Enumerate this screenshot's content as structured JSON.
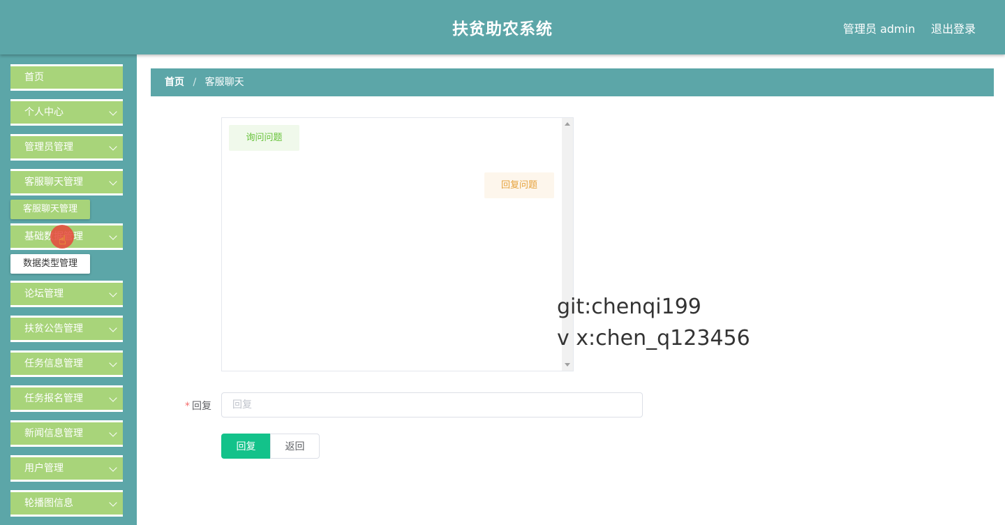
{
  "header": {
    "title": "扶贫助农系统",
    "user_label": "管理员 admin",
    "logout_label": "退出登录"
  },
  "sidebar": {
    "items": [
      {
        "label": "首页",
        "has_arrow": false
      },
      {
        "label": "个人中心",
        "has_arrow": true
      },
      {
        "label": "管理员管理",
        "has_arrow": true
      },
      {
        "label": "客服聊天管理",
        "has_arrow": true
      },
      {
        "label": "基础数据管理",
        "has_arrow": true
      },
      {
        "label": "论坛管理",
        "has_arrow": true
      },
      {
        "label": "扶贫公告管理",
        "has_arrow": true
      },
      {
        "label": "任务信息管理",
        "has_arrow": true
      },
      {
        "label": "任务报名管理",
        "has_arrow": true
      },
      {
        "label": "新闻信息管理",
        "has_arrow": true
      },
      {
        "label": "用户管理",
        "has_arrow": true
      },
      {
        "label": "轮播图信息",
        "has_arrow": true
      }
    ],
    "submenus": [
      {
        "label": "客服聊天管理"
      },
      {
        "label": "数据类型管理"
      }
    ]
  },
  "breadcrumb": {
    "home": "首页",
    "separator": "/",
    "current": "客服聊天"
  },
  "chat": {
    "ask": "询问问题",
    "reply": "回复问题"
  },
  "watermark": {
    "line1": "git:chenqi199",
    "line2": "v x:chen_q123456"
  },
  "form": {
    "required_mark": "*",
    "label": "回复",
    "placeholder": "回复",
    "value": ""
  },
  "buttons": {
    "submit": "回复",
    "back": "返回"
  },
  "colors": {
    "theme": "#5ca6a8",
    "menu": "#a8d47a",
    "primary_button": "#13c28a"
  }
}
